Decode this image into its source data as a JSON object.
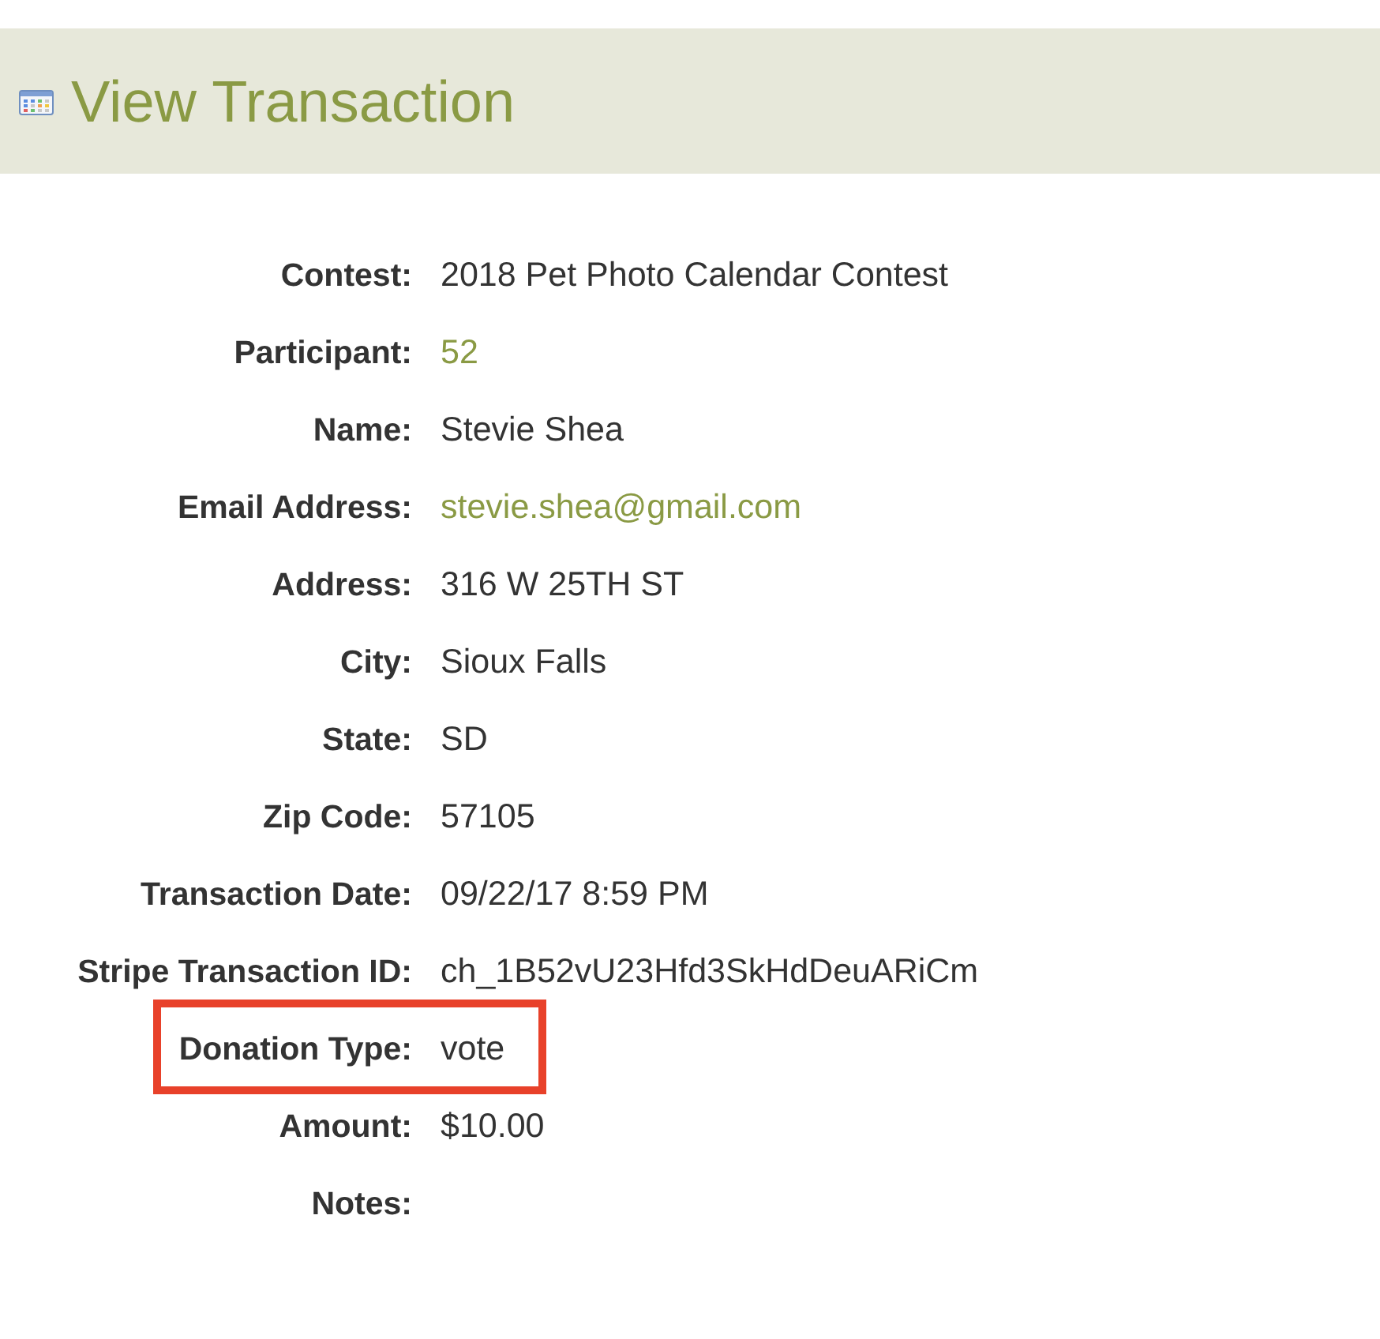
{
  "page": {
    "title": "View Transaction"
  },
  "fields": [
    {
      "label": "Contest:",
      "value": "2018 Pet Photo Calendar Contest",
      "kind": "text",
      "highlighted": false
    },
    {
      "label": "Participant:",
      "value": "52",
      "kind": "link",
      "highlighted": false
    },
    {
      "label": "Name:",
      "value": "Stevie Shea",
      "kind": "text",
      "highlighted": false
    },
    {
      "label": "Email Address:",
      "value": "stevie.shea@gmail.com",
      "kind": "link",
      "highlighted": false
    },
    {
      "label": "Address:",
      "value": "316 W 25TH ST",
      "kind": "text",
      "highlighted": false
    },
    {
      "label": "City:",
      "value": "Sioux Falls",
      "kind": "text",
      "highlighted": false
    },
    {
      "label": "State:",
      "value": "SD",
      "kind": "text",
      "highlighted": false
    },
    {
      "label": "Zip Code:",
      "value": "57105",
      "kind": "text",
      "highlighted": false
    },
    {
      "label": "Transaction Date:",
      "value": "09/22/17 8:59 PM",
      "kind": "text",
      "highlighted": false
    },
    {
      "label": "Stripe Transaction ID:",
      "value": "ch_1B52vU23Hfd3SkHdDeuARiCm",
      "kind": "text",
      "highlighted": false
    },
    {
      "label": "Donation Type:",
      "value": "vote",
      "kind": "text",
      "highlighted": true
    },
    {
      "label": "Amount:",
      "value": "$10.00",
      "kind": "text",
      "highlighted": false
    },
    {
      "label": "Notes:",
      "highlighted": false
    }
  ]
}
